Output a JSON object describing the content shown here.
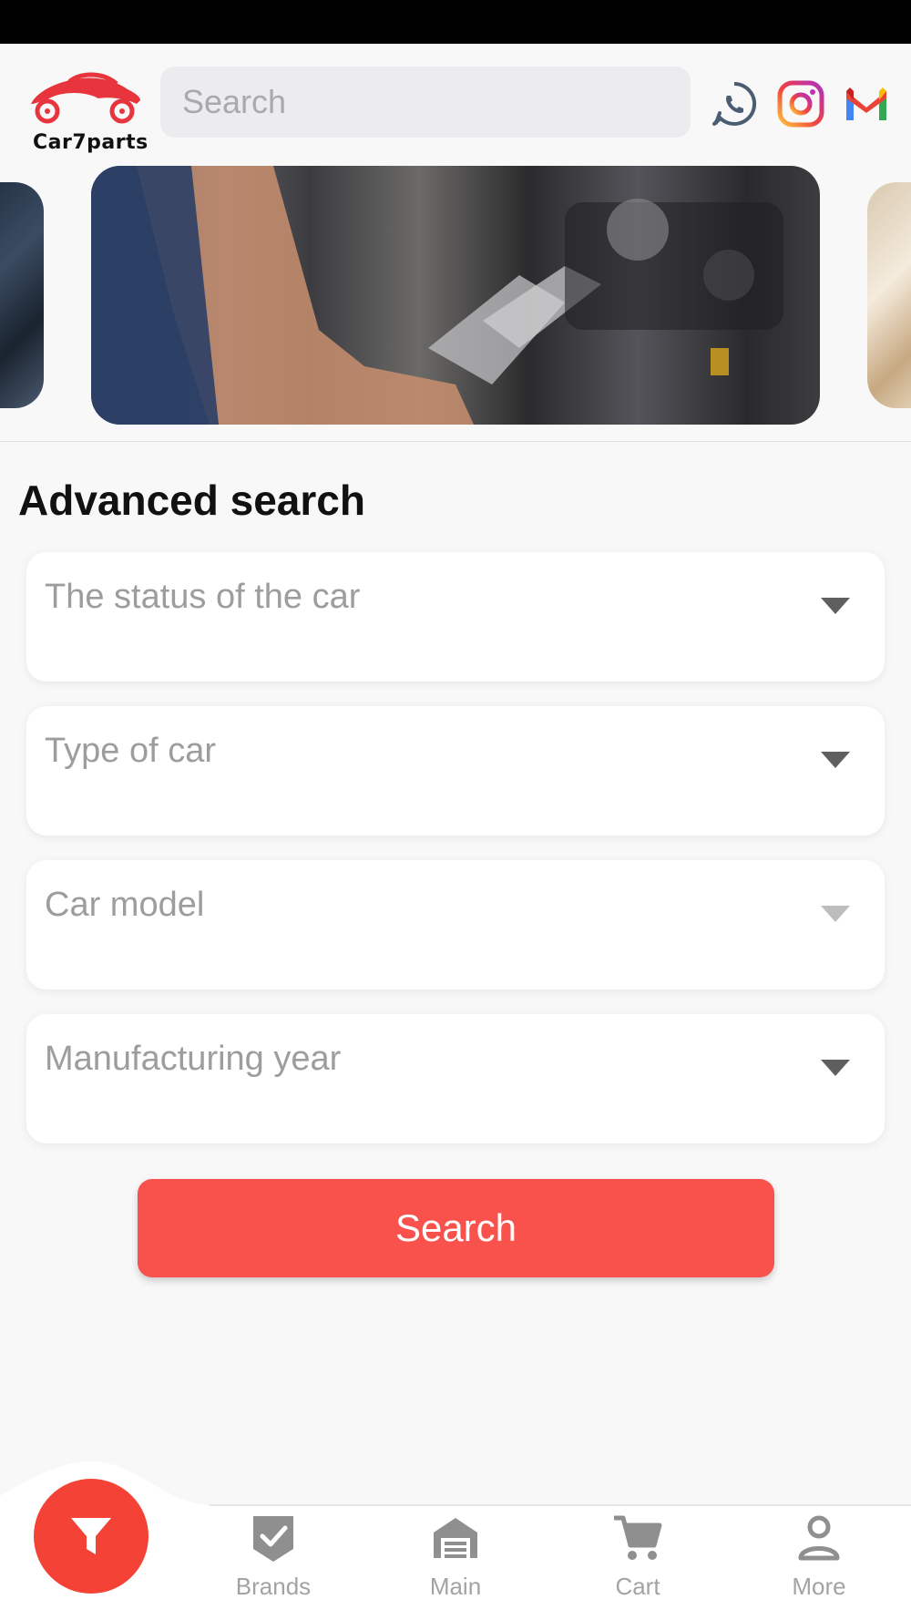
{
  "header": {
    "logo_text": "Car7parts",
    "search_placeholder": "Search",
    "social_icons": [
      "whatsapp-icon",
      "instagram-icon",
      "gmail-icon"
    ]
  },
  "advanced_search": {
    "title": "Advanced search",
    "fields": [
      {
        "label": "The status of the car"
      },
      {
        "label": "Type of car"
      },
      {
        "label": "Car model"
      },
      {
        "label": "Manufacturing year"
      }
    ],
    "search_button": "Search"
  },
  "bottom_nav": {
    "items": [
      {
        "label": "Brands",
        "icon": "check-badge-icon"
      },
      {
        "label": "Main",
        "icon": "garage-icon"
      },
      {
        "label": "Cart",
        "icon": "cart-icon"
      },
      {
        "label": "More",
        "icon": "person-icon"
      }
    ],
    "fab_icon": "filter-icon"
  },
  "colors": {
    "accent": "#f9514b",
    "fab": "#f44336",
    "nav_label": "#a3a3a3",
    "placeholder": "#9d9d9d"
  }
}
